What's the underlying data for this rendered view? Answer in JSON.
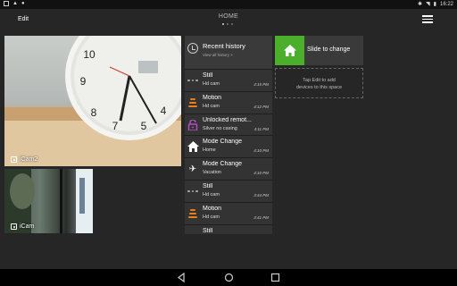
{
  "status_bar": {
    "time": "16:22"
  },
  "app_bar": {
    "edit_label": "Edit",
    "title": "HOME"
  },
  "cameras": [
    {
      "label": "iCam2"
    },
    {
      "label": "iCam"
    }
  ],
  "history": {
    "title": "Recent history",
    "subtitle": "View all history >",
    "events": [
      {
        "icon": "dots-icon",
        "name": "Still",
        "source": "Hd cam",
        "time": "4:15 PM"
      },
      {
        "icon": "motion-icon",
        "name": "Motion",
        "source": "Hd cam",
        "time": "4:12 PM"
      },
      {
        "icon": "unlock-icon",
        "name": "Unlocked remot...",
        "source": "Silver no casing",
        "time": "4:11 PM"
      },
      {
        "icon": "home-icon",
        "name": "Mode Change",
        "source": "Home",
        "time": "4:10 PM"
      },
      {
        "icon": "airplane-icon",
        "name": "Mode Change",
        "source": "Vacation",
        "time": "4:10 PM"
      },
      {
        "icon": "dots-icon",
        "name": "Still",
        "source": "Hd cam",
        "time": "3:44 PM"
      },
      {
        "icon": "motion-icon",
        "name": "Motion",
        "source": "Hd cam",
        "time": "3:41 PM"
      },
      {
        "icon": "dots-icon",
        "name": "Still",
        "source": "",
        "time": ""
      }
    ]
  },
  "mode_slider": {
    "label": "Slide to change",
    "accent": "#4caf2c"
  },
  "add_devices": {
    "line1": "Tap Edit to add",
    "line2": "devices to this space"
  },
  "colors": {
    "motion": "#e8801e",
    "unlock": "#b04fc0"
  }
}
